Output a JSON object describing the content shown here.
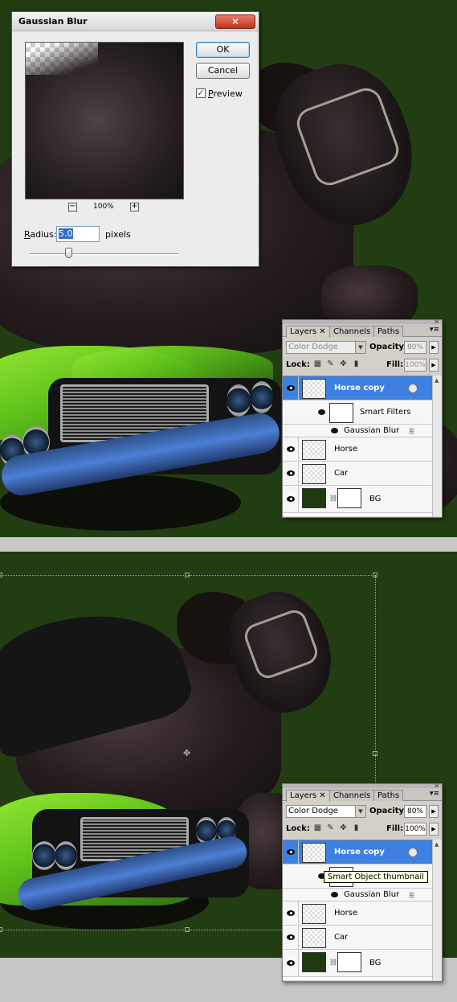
{
  "gaussian_blur": {
    "title": "Gaussian Blur",
    "ok_label": "OK",
    "cancel_label": "Cancel",
    "preview_label": "Preview",
    "preview_checked": true,
    "zoom_out": "−",
    "zoom_in": "+",
    "zoom_level": "100%",
    "radius_label": "Radius:",
    "radius_value": "5.0",
    "radius_unit": "pixels"
  },
  "layers_before": {
    "tabs": [
      "Layers",
      "Channels",
      "Paths"
    ],
    "blend_mode": "Color Dodge",
    "opacity_label": "Opacity:",
    "opacity_value": "80%",
    "lock_label": "Lock:",
    "fill_label": "Fill:",
    "fill_value": "100%",
    "layers": [
      {
        "name": "Horse copy",
        "selected": true,
        "smart_object": true
      },
      {
        "name": "Smart Filters",
        "sub": true
      },
      {
        "name": "Gaussian Blur",
        "sub": true
      },
      {
        "name": "Horse"
      },
      {
        "name": "Car"
      },
      {
        "name": "BG"
      }
    ]
  },
  "layers_after": {
    "tabs": [
      "Layers",
      "Channels",
      "Paths"
    ],
    "blend_mode": "Color Dodge",
    "opacity_label": "Opacity:",
    "opacity_value": "80%",
    "lock_label": "Lock:",
    "fill_label": "Fill:",
    "fill_value": "100%",
    "tooltip": "Smart Object thumbnail",
    "layers": [
      {
        "name": "Horse copy",
        "selected": true,
        "smart_object": true
      },
      {
        "name": "Gaussian Blur",
        "sub": true
      },
      {
        "name": "Horse"
      },
      {
        "name": "Car"
      },
      {
        "name": "BG"
      }
    ]
  },
  "icons": {
    "close": "close-icon",
    "eye": "eye-icon",
    "lock_transparent": "lock-transparent-icon",
    "lock_paint": "lock-paint-icon",
    "lock_move": "lock-move-icon",
    "lock_all": "lock-all-icon",
    "panel_menu": "panel-menu-icon",
    "filter_options": "filter-options-icon",
    "chain": "chain-icon"
  },
  "colors": {
    "canvas_bg": "#223d11",
    "selected_layer": "#3d80df",
    "close_button": "#c0321b"
  }
}
